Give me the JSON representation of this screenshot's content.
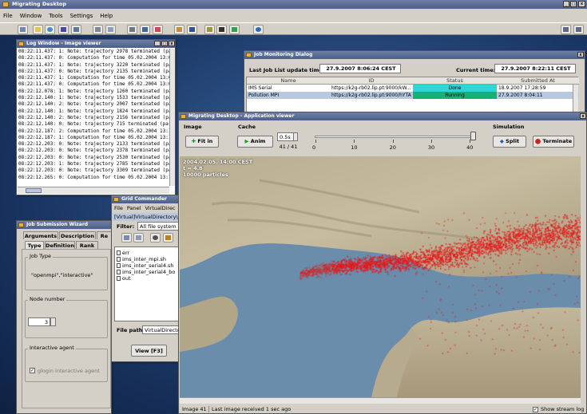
{
  "app": {
    "title": "Migrating Desktop",
    "menu": [
      "File",
      "Window",
      "Tools",
      "Settings",
      "Help"
    ],
    "colors": {
      "accent": "#4c5f8a",
      "done": "#2fd6d6",
      "running": "#18b070",
      "particles": "#e61a1a"
    }
  },
  "log_window": {
    "title": "Log Window - Image viewer",
    "lines": [
      "08:22:11.437: 1: Note: trajectory 2978 terminated (particle pos",
      "08:22:11.437: 0: Computation for time 05.02.2004 13:07:30 U",
      "08:22:11.437: 1: Note: trajectory 3220 terminated (particle pos",
      "08:22:11.437: 0: Note: trajectory 2135 terminated (particle pos",
      "08:22:11.437: 1: Computation for time 05.02.2004 13:07:30 U",
      "08:22:11.437: 0: Computation for time 05.02.2004 13:07:30 U",
      "08:22:12.078: 1: Note: trajectory 1260 terminated (particle pos",
      "08:22:12.140: 1: Note: trajectory 1533 terminated (particle pos",
      "08:22:12.140: 2: Note: trajectory 2007 terminated (particle pos",
      "08:22:12.140: 1: Note: trajectory 1824 terminated (particle pos",
      "08:22:12.140: 2: Note: trajectory 2156 terminated (particle pos",
      "08:22:12.140: 0: Note: trajectory 715 terminated (particle posit",
      "08:22:12.187: 2: Computation for time 05.02.2004 13:15:00 U",
      "08:22:12.187: 1: Computation for time 05.02.2004 13:15:00 U",
      "08:22:12.203: 0: Note: trajectory 2133 terminated (particle pos",
      "08:22:12.203: 0: Note: trajectory 2378 terminated (particle pos",
      "08:22:12.203: 0: Note: trajectory 2530 terminated (particle pos",
      "08:22:12.203: 1: Note: trajectory 2785 terminated (particle pos",
      "08:22:12.203: 0: Note: trajectory 3309 terminated (particle pos",
      "08:22:12.265: 0: Computation for time 05.02.2004 13:15:00 U"
    ]
  },
  "job_monitoring": {
    "title": "Job Monitoring Dialog",
    "last_update_label": "Last Job List update time:",
    "last_update_value": "27.9.2007 8:06:24 CEST",
    "current_time_label": "Current time:",
    "current_time_value": "27.9.2007 8:22:11 CEST",
    "columns": [
      "Name",
      "ID",
      "Status",
      "Submitted At"
    ],
    "rows": [
      {
        "name": "IMS Serial",
        "id": "https://k2g-rb02.lip.pt:9000/kW...",
        "status": "Done",
        "submitted": "18.9.2007 17:28:59"
      },
      {
        "name": "Pollution MPI",
        "id": "https://k2g-rb02.lip.pt:9000/hYTA...",
        "status": "Running",
        "submitted": "27.9.2007 8:04:11"
      }
    ]
  },
  "app_viewer": {
    "title": "Migrating Desktop - Application viewer",
    "image_label": "Image",
    "cache_label": "Cache",
    "simulation_label": "Simulation",
    "fit_in": "Fit in",
    "anim": "Anim",
    "interval": "0.5s",
    "frame_counter": "41 / 41",
    "slider_ticks": [
      "0",
      "10",
      "20",
      "30",
      "40"
    ],
    "slider_value": 41,
    "slider_max": 41,
    "split": "Split",
    "terminate": "Terminate",
    "overlay": [
      "2004.02.05. 14:00 CEST",
      "t = 4.8",
      "10000 particles"
    ],
    "status_image": "Image 41",
    "status_text": "Last image received 1 sec ago",
    "show_stream_log": "Show stream log"
  },
  "grid_commander": {
    "title": "Grid Commander",
    "menu": [
      "File",
      "Panel",
      "VirtualDirec"
    ],
    "path": "[Virtual]VirtualDirectory\\",
    "filter_label": "Filter:",
    "filter_value": "All file system",
    "files": [
      "err",
      "ims_inter_mpi.sh",
      "ims_inter_serial4.sh",
      "ims_inter_serial4_bo",
      "out"
    ],
    "file_path_label": "File path:",
    "file_path_value": "VirtualDirecto",
    "view_button": "View [F3]"
  },
  "job_wizard": {
    "title": "Job Submission Wizard",
    "tabs_row1": [
      "Arguments",
      "Description",
      "Re"
    ],
    "tabs_row2": [
      "Type",
      "Definition",
      "Rank"
    ],
    "job_type_label": "Job Type",
    "job_type_value": "\"openmpi\",\"interactive\"",
    "node_number_label": "Node number",
    "node_number_value": "3",
    "interactive_agent_label": "Interactive agent",
    "glogin_label": "glogin interactive agent"
  }
}
